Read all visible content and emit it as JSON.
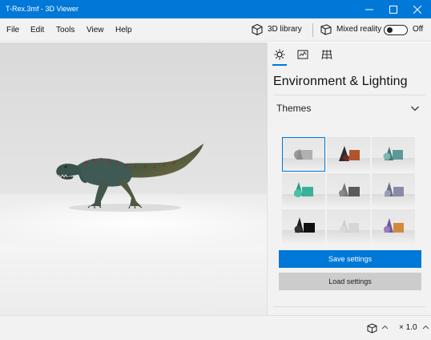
{
  "window": {
    "title": "T-Rex.3mf - 3D Viewer"
  },
  "menu": {
    "items": [
      "File",
      "Edit",
      "Tools",
      "View",
      "Help"
    ]
  },
  "toolbar": {
    "library_label": "3D library",
    "mixed_reality_label": "Mixed reality",
    "mixed_reality_state": "Off",
    "mixed_reality_on": false
  },
  "panel": {
    "tabs": [
      "lighting-tab",
      "stats-tab",
      "grid-tab"
    ],
    "active_tab": "lighting-tab",
    "title": "Environment & Lighting",
    "themes_label": "Themes",
    "save_label": "Save settings",
    "load_label": "Load settings",
    "selected_theme_index": 0
  },
  "status": {
    "zoom": "× 1.0"
  },
  "colors": {
    "accent": "#0078d7",
    "titlebar": "#0078d7"
  }
}
